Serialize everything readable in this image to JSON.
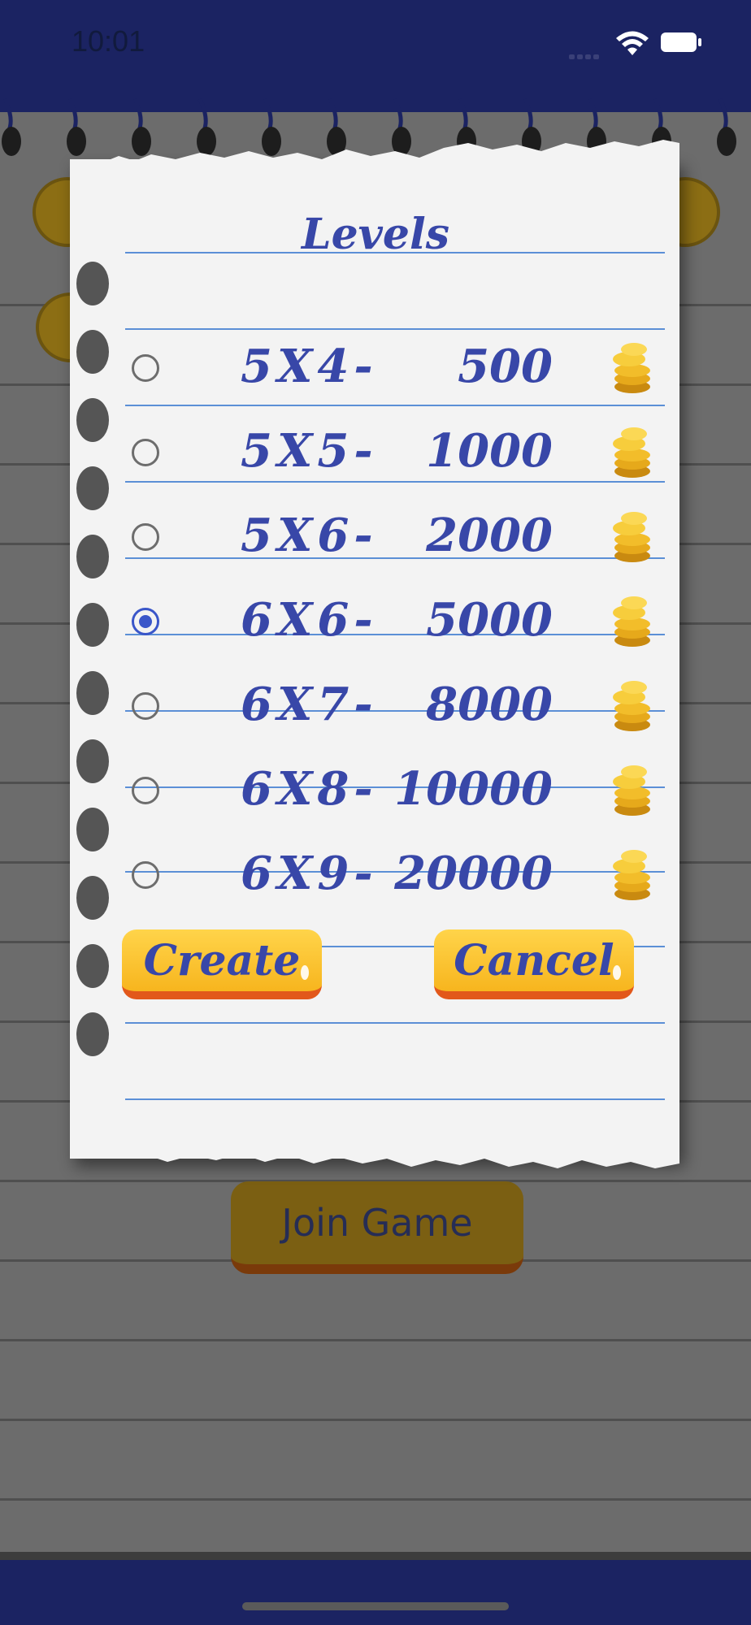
{
  "status_bar": {
    "time": "10:01"
  },
  "background": {
    "join_button_label": "Join Game"
  },
  "dialog": {
    "title": "Levels",
    "levels": [
      {
        "size": "5X4-",
        "price": "500",
        "selected": false
      },
      {
        "size": "5X5-",
        "price": "1000",
        "selected": false
      },
      {
        "size": "5X6-",
        "price": "2000",
        "selected": false
      },
      {
        "size": "6X6-",
        "price": "5000",
        "selected": true
      },
      {
        "size": "6X7-",
        "price": "8000",
        "selected": false
      },
      {
        "size": "6X8-",
        "price": "10000",
        "selected": false
      },
      {
        "size": "6X9-",
        "price": "20000",
        "selected": false
      }
    ],
    "create_label": "Create",
    "cancel_label": "Cancel"
  },
  "colors": {
    "header": "#1b2362",
    "ink_blue": "#3847a8",
    "ruled_line": "#5b8fd6",
    "button_yellow": "#f7b51e",
    "radio_selected": "#3a56c9"
  },
  "icons": [
    "wifi-icon",
    "battery-icon",
    "signal-icon",
    "back-arrow-icon",
    "gear-icon",
    "coin-stack-icon"
  ]
}
